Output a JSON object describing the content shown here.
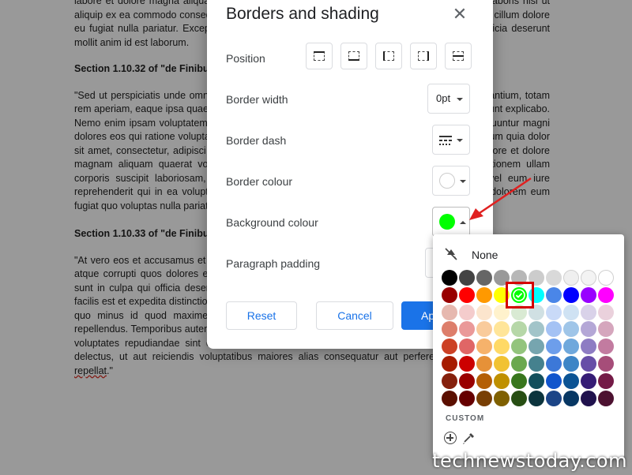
{
  "document": {
    "para1": "labore et dolore magna aliqua. Ut enim ad minim veniam, quis nostrud exercitation ullamco laboris nisi ut aliquip ex ea commodo consequat. Duis aute irure dolor in reprehenderit in voluptate velit esse cillum dolore eu fugiat nulla pariatur. Excepteur sint occaecat cupidatat non proident, sunt in culpa qui officia deserunt mollit anim id est laborum.",
    "heading1": "Section 1.10.32 of \"de Finibus Bonorum et Malorum\", written by Cicero in 45 BC",
    "para2": "\"Sed ut perspiciatis unde omnis iste natus error sit voluptatem accusantium doloremque laudantium, totam rem aperiam, eaque ipsa quae ab illo inventore veritatis et quasi architecto beatae vitae dicta sunt explicabo. Nemo enim ipsam voluptatem quia voluptas sit aspernatur aut odit aut fugit, sed quia consequuntur magni dolores eos qui ratione voluptatem sequi nesciunt. Neque porro quisquam est, qui dolorem ipsum quia dolor sit amet, consectetur, adipisci velit, sed quia non numquam eius modi tempora incidunt ut labore et dolore magnam aliquam quaerat voluptatem. Ut enim ad minima veniam, quis nostrum exercitationem ullam corporis suscipit laboriosam, nisi ut aliquid ex ea commodi consequatur? Quis autem vel eum iure reprehenderit qui in ea voluptate velit esse quam nihil molestiae consequatur, vel illum qui dolorem eum fugiat quo voluptas nulla pariatur\"",
    "heading2": "Section 1.10.33 of \"de Finibus Bonorum et Malorum\", written by Cicero in 45 BC",
    "para3a": "\"At vero eos et accusamus et iusto odio dignissimos ducimus qui blanditiis praesentium voluptatum deleniti atque corrupti quos dolores et quas molestias excepturi sint occaecati cupiditate non provident, similique sunt in culpa qui officia deserunt mollitia animi, id est laborum et dolorum fuga. Et harum quidem rerum facilis est et expedita distinctio. Nam libero tempore, cum soluta nobis est eligendi optio cumque nihil impedit quo minus id quod maxime placeat facere possimus, omnis voluptas assumenda est, omnis dolor repellendus. Temporibus autem quibusdam et aut officiis debitis aut rerum necessitatibus saepe eveniet ut et voluptates repudiandae sint et molestiae non recusandae. Itaque earum rerum hic tenetur a sapiente delectus, ut aut reiciendis voluptatibus maiores alias consequatur aut perferendis doloribus asperiores ",
    "para3_misspell": "repellat",
    "para3b": ".\""
  },
  "dialog": {
    "title": "Borders and shading",
    "close_icon": "close-icon",
    "position_label": "Position",
    "position_buttons": [
      "border-top",
      "border-bottom",
      "border-left",
      "border-right",
      "border-between"
    ],
    "border_width_label": "Border width",
    "border_width_value": "0pt",
    "border_dash_label": "Border dash",
    "border_colour_label": "Border colour",
    "border_colour_value": "#ffffff",
    "background_colour_label": "Background colour",
    "background_colour_value": "#00ff00",
    "paragraph_padding_label": "Paragraph padding",
    "reset_label": "Reset",
    "cancel_label": "Cancel",
    "apply_label": "Ap"
  },
  "palette": {
    "none_label": "None",
    "custom_label": "CUSTOM",
    "selected": "#00ff00",
    "rows": [
      [
        "#000000",
        "#434343",
        "#666666",
        "#999999",
        "#b7b7b7",
        "#cccccc",
        "#d9d9d9",
        "#efefef",
        "#f3f3f3",
        "#ffffff"
      ],
      [
        "#980000",
        "#ff0000",
        "#ff9900",
        "#ffff00",
        "#00ff00",
        "#00ffff",
        "#4a86e8",
        "#0000ff",
        "#9900ff",
        "#ff00ff"
      ],
      [
        "#e6b8af",
        "#f4cccc",
        "#fce5cd",
        "#fff2cc",
        "#d9ead3",
        "#d0e0e3",
        "#c9daf8",
        "#cfe2f3",
        "#d9d2e9",
        "#ead1dc"
      ],
      [
        "#dd7e6b",
        "#ea9999",
        "#f9cb9c",
        "#ffe599",
        "#b6d7a8",
        "#a2c4c9",
        "#a4c2f4",
        "#9fc5e8",
        "#b4a7d6",
        "#d5a6bd"
      ],
      [
        "#cc4125",
        "#e06666",
        "#f6b26b",
        "#ffd966",
        "#93c47d",
        "#76a5af",
        "#6d9eeb",
        "#6fa8dc",
        "#8e7cc3",
        "#c27ba0"
      ],
      [
        "#a61c00",
        "#cc0000",
        "#e69138",
        "#f1c232",
        "#6aa84f",
        "#45818e",
        "#3c78d8",
        "#3d85c6",
        "#674ea7",
        "#a64d79"
      ],
      [
        "#85200c",
        "#990000",
        "#b45f06",
        "#bf9000",
        "#38761d",
        "#134f5c",
        "#1155cc",
        "#0b5394",
        "#351c75",
        "#741b47"
      ],
      [
        "#5b0f00",
        "#660000",
        "#783f04",
        "#7f6000",
        "#274e13",
        "#0c343d",
        "#1c4587",
        "#073763",
        "#20124d",
        "#4c1130"
      ]
    ]
  },
  "watermark": "technewstoday.com",
  "colors": {
    "accent": "#1a73e8",
    "highlight": "#d40000",
    "arrow": "#e02020"
  }
}
